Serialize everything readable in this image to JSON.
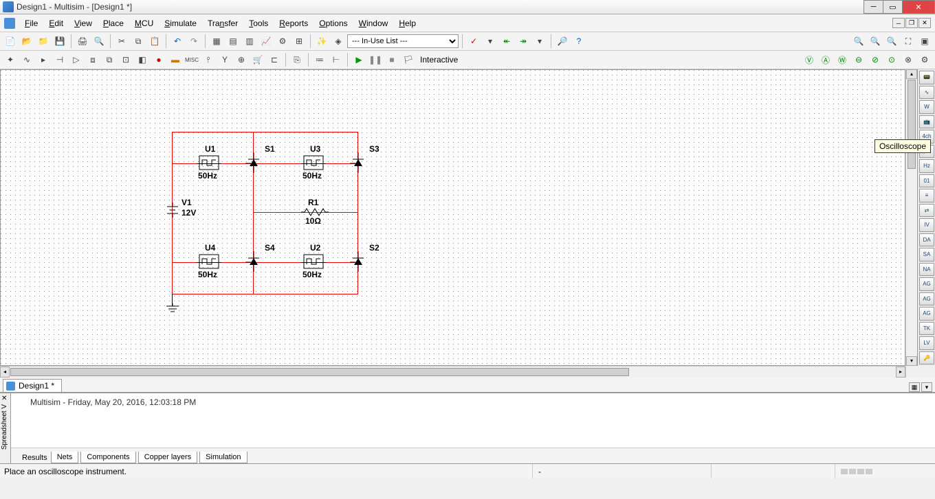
{
  "title": "Design1 - Multisim - [Design1 *]",
  "menus": [
    "File",
    "Edit",
    "View",
    "Place",
    "MCU",
    "Simulate",
    "Transfer",
    "Tools",
    "Reports",
    "Options",
    "Window",
    "Help"
  ],
  "combo1": "--- In-Use List ---",
  "interactiveLabel": "Interactive",
  "docTab": "Design1 *",
  "tooltip": "Oscilloscope",
  "log": {
    "text": "Multisim  -  Friday, May 20, 2016, 12:03:18 PM",
    "gutter": "Spreadsheet V",
    "tabs": [
      "Results",
      "Nets",
      "Components",
      "Copper layers",
      "Simulation"
    ]
  },
  "status": {
    "msg": "Place an oscilloscope instrument.",
    "dash": "-"
  },
  "schematic": {
    "V1": {
      "name": "V1",
      "val": "12V"
    },
    "R1": {
      "name": "R1",
      "val": "10Ω"
    },
    "U1": {
      "name": "U1",
      "val": "50Hz"
    },
    "U2": {
      "name": "U2",
      "val": "50Hz"
    },
    "U3": {
      "name": "U3",
      "val": "50Hz"
    },
    "U4": {
      "name": "U4",
      "val": "50Hz"
    },
    "S1": "S1",
    "S2": "S2",
    "S3": "S3",
    "S4": "S4"
  }
}
